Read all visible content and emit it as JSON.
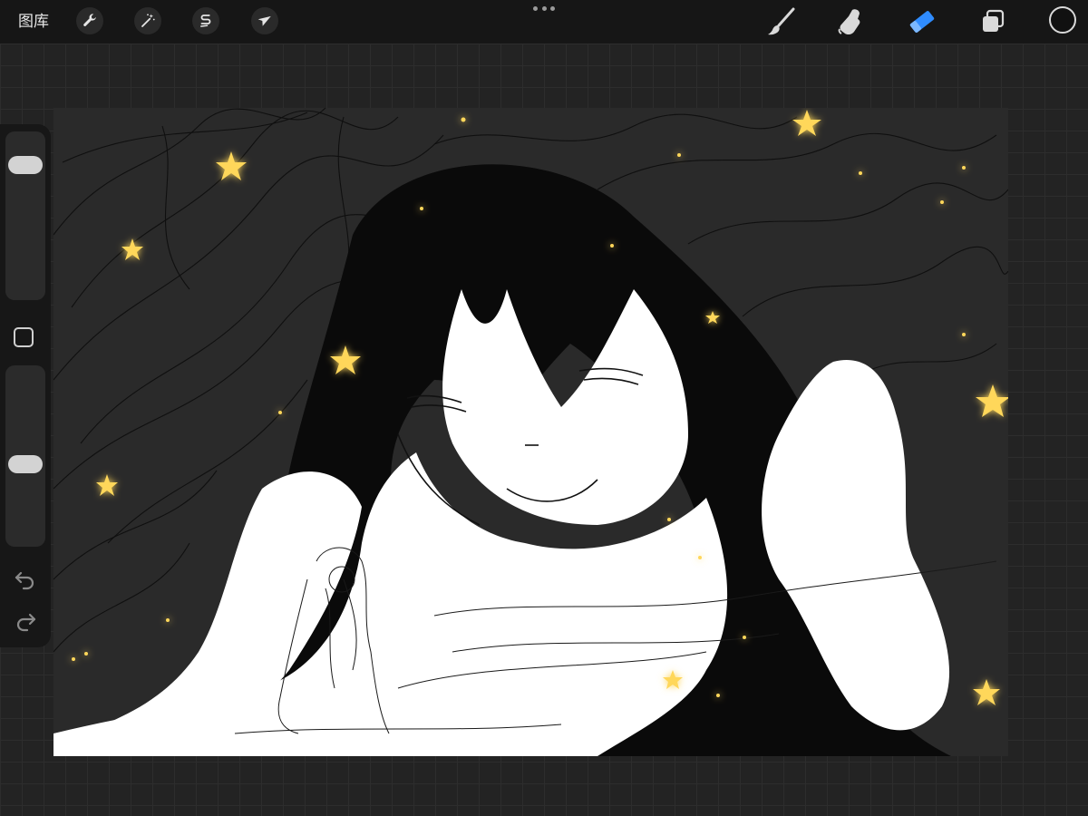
{
  "toolbar": {
    "gallery_label": "图库",
    "left_tools": [
      "wrench-icon",
      "magic-wand-icon",
      "selection-icon",
      "transform-arrow-icon"
    ],
    "right_tools": [
      "brush-icon",
      "smudge-icon",
      "eraser-icon",
      "layers-icon"
    ],
    "active_tool": "eraser-icon",
    "accent_color": "#2f8cff",
    "current_color": "#111111"
  },
  "sidebar": {
    "brush_size_level": 0.85,
    "opacity_level": 0.45
  },
  "canvas": {
    "background_color": "#2a2a2a",
    "star_color": "#ffd75a"
  }
}
